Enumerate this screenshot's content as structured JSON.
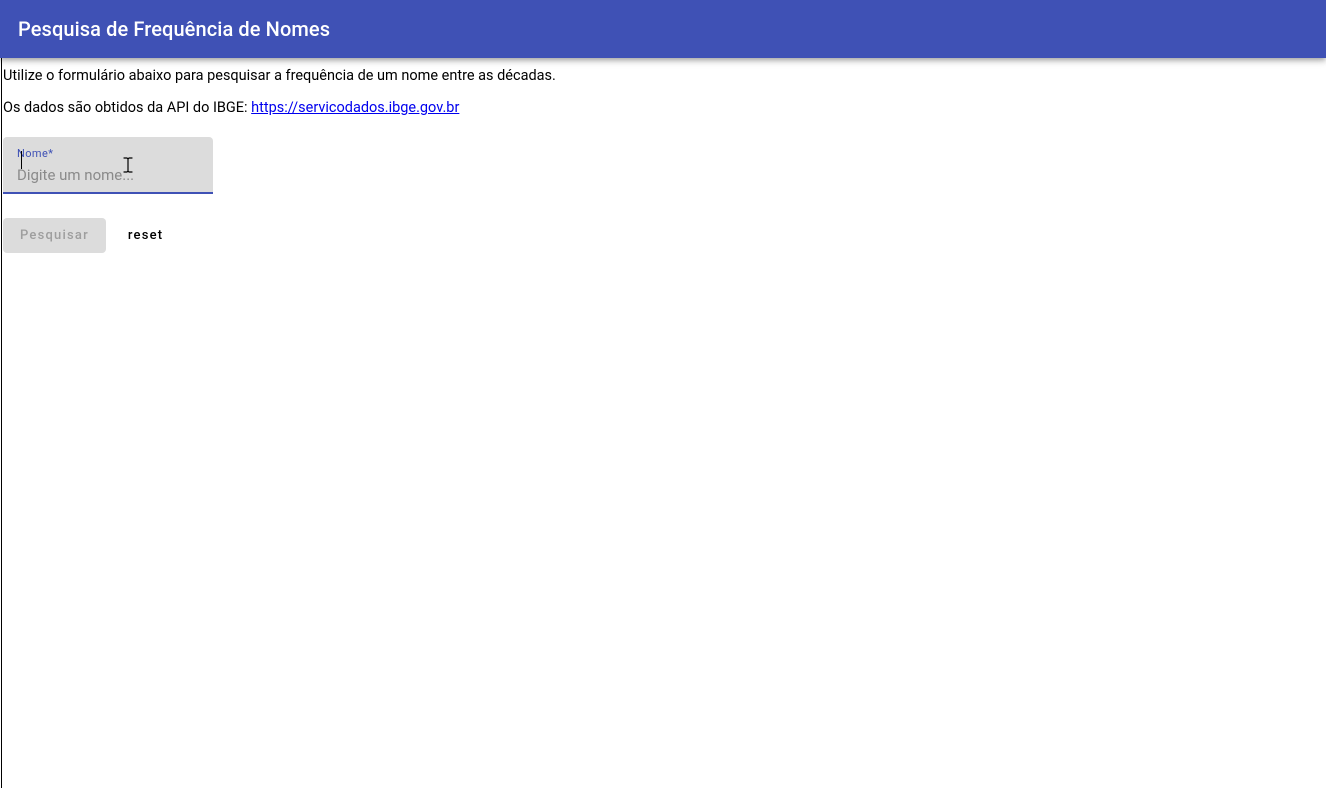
{
  "header": {
    "title": "Pesquisa de Frequência de Nomes"
  },
  "intro": {
    "description": "Utilize o formulário abaixo para pesquisar a frequência de um nome entre as décadas.",
    "sourcePrefix": "Os dados são obtidos da API do IBGE: ",
    "sourceLinkText": "https://servicodados.ibge.gov.br"
  },
  "form": {
    "nameField": {
      "label": "Nome",
      "required": "*",
      "placeholder": "Digite um nome...",
      "value": ""
    },
    "searchButton": "Pesquisar",
    "resetButton": "reset"
  }
}
